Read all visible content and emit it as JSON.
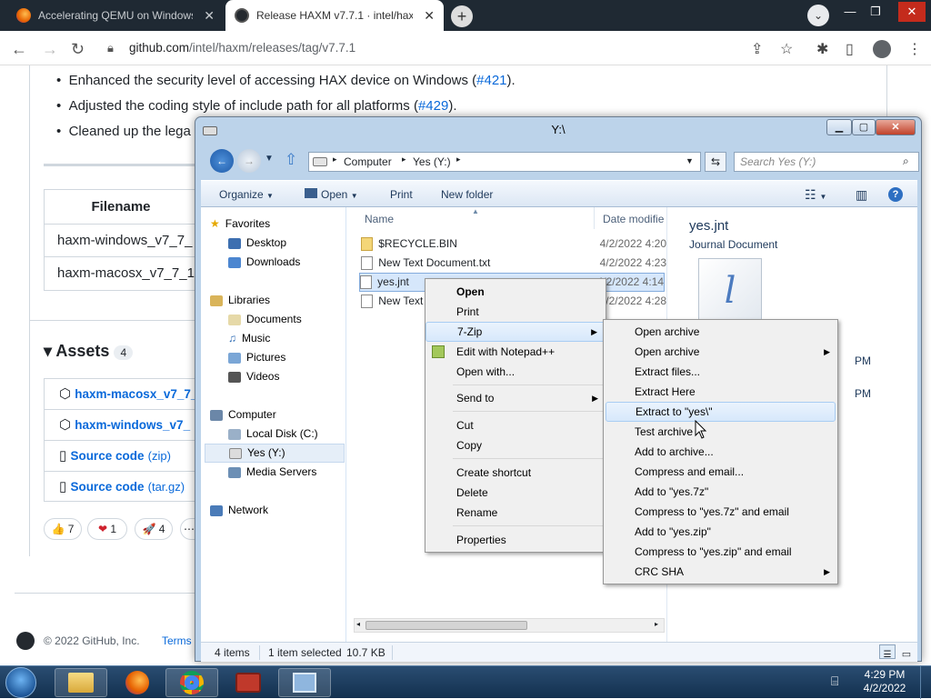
{
  "browser": {
    "tabs": [
      {
        "title": "Accelerating QEMU on Windows"
      },
      {
        "title": "Release HAXM v7.7.1 · intel/haxm"
      }
    ],
    "url_host": "github.com",
    "url_path": "/intel/haxm/releases/tag/v7.7.1"
  },
  "github": {
    "bullets": [
      {
        "text": "Enhanced the security level of accessing HAX device on Windows (",
        "link": "#421",
        "tail": ")."
      },
      {
        "text": "Adjusted the coding style of include path for all platforms (",
        "link": "#429",
        "tail": ")."
      },
      {
        "text": "Cleaned up the lega",
        "link": "",
        "tail": ""
      }
    ],
    "file_table": {
      "header": "Filename",
      "rows": [
        "haxm-windows_v7_7_",
        "haxm-macosx_v7_7_1"
      ]
    },
    "assets_title": "Assets",
    "assets_count": "4",
    "assets": [
      {
        "name": "haxm-macosx_v7_7_",
        "suffix": ""
      },
      {
        "name": "haxm-windows_v7_",
        "suffix": ""
      },
      {
        "name": "Source code",
        "suffix": "(zip)"
      },
      {
        "name": "Source code",
        "suffix": "(tar.gz)"
      }
    ],
    "reactions": [
      {
        "emoji": "👍",
        "count": "7"
      },
      {
        "emoji": "❤",
        "count": "1"
      },
      {
        "emoji": "🚀",
        "count": "4"
      }
    ],
    "footer_copyright": "© 2022 GitHub, Inc.",
    "footer_terms": "Terms"
  },
  "explorer": {
    "title": "Y:\\",
    "breadcrumb": [
      "Computer",
      "Yes (Y:)"
    ],
    "search_placeholder": "Search Yes (Y:)",
    "toolbar": {
      "organize": "Organize",
      "open": "Open",
      "print": "Print",
      "new_folder": "New folder"
    },
    "nav": {
      "favorites": "Favorites",
      "desktop": "Desktop",
      "downloads": "Downloads",
      "libraries": "Libraries",
      "documents": "Documents",
      "music": "Music",
      "pictures": "Pictures",
      "videos": "Videos",
      "computer": "Computer",
      "local_disk": "Local Disk (C:)",
      "yes_drive": "Yes (Y:)",
      "media_servers": "Media Servers",
      "network": "Network"
    },
    "columns": {
      "name": "Name",
      "date": "Date modifie"
    },
    "files": [
      {
        "name": "$RECYCLE.BIN",
        "date": "4/2/2022 4:20"
      },
      {
        "name": "New Text Document.txt",
        "date": "4/2/2022 4:23"
      },
      {
        "name": "yes.jnt",
        "date": "4/2/2022 4:14"
      },
      {
        "name": "New Text",
        "date": "4/2/2022 4:28"
      }
    ],
    "preview": {
      "name": "yes.jnt",
      "type": "Journal Document",
      "pm1": "PM",
      "pm2": "PM"
    },
    "status": {
      "items": "4 items",
      "selected": "1 item selected",
      "size": "10.7 KB"
    }
  },
  "context_menu": {
    "items": [
      "Open",
      "Print",
      "7-Zip",
      "Edit with Notepad++",
      "Open with...",
      "Send to",
      "Cut",
      "Copy",
      "Create shortcut",
      "Delete",
      "Rename",
      "Properties"
    ]
  },
  "zip_menu": {
    "items": [
      "Open archive",
      "Open archive",
      "Extract files...",
      "Extract Here",
      "Extract to \"yes\\\"",
      "Test archive",
      "Add to archive...",
      "Compress and email...",
      "Add to \"yes.7z\"",
      "Compress to \"yes.7z\" and email",
      "Add to \"yes.zip\"",
      "Compress to \"yes.zip\" and email",
      "CRC SHA"
    ]
  },
  "taskbar": {
    "time": "4:29 PM",
    "date": "4/2/2022"
  }
}
